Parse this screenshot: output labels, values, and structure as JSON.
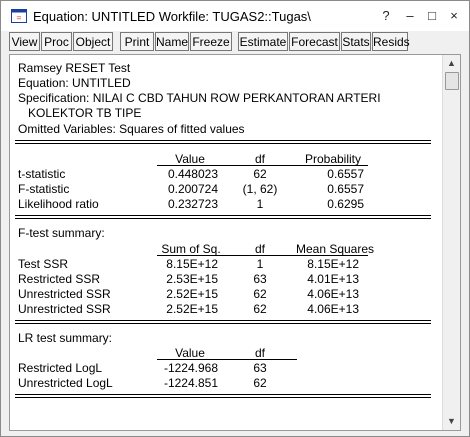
{
  "window": {
    "title": "Equation: UNTITLED   Workfile: TUGAS2::Tugas\\",
    "controls": [
      "?",
      "–",
      "□",
      "×"
    ]
  },
  "toolbar": {
    "buttons": [
      "View",
      "Proc",
      "Object",
      "Print",
      "Name",
      "Freeze",
      "Estimate",
      "Forecast",
      "Stats",
      "Resids"
    ]
  },
  "output": {
    "heading": "Ramsey RESET Test",
    "equation": "Equation: UNTITLED",
    "specification_line1": "Specification: NILAI C CBD TAHUN ROW PERKANTORAN ARTERI",
    "specification_line2": "KOLEKTOR TB TIPE",
    "omitted": "Omitted Variables: Squares of fitted values",
    "test_table": {
      "headers": [
        "Value",
        "df",
        "Probability"
      ],
      "rows": [
        {
          "label": "t-statistic",
          "value": "0.448023",
          "df": "62",
          "prob": "0.6557"
        },
        {
          "label": "F-statistic",
          "value": "0.200724",
          "df": "(1, 62)",
          "prob": "0.6557"
        },
        {
          "label": "Likelihood ratio",
          "value": "0.232723",
          "df": "1",
          "prob": "0.6295"
        }
      ]
    },
    "ftest": {
      "title": "F-test summary:",
      "headers": [
        "Sum of Sq.",
        "df",
        "Mean Squares"
      ],
      "rows": [
        {
          "label": "Test SSR",
          "ss": "8.15E+12",
          "df": "1",
          "ms": "8.15E+12"
        },
        {
          "label": "Restricted SSR",
          "ss": "2.53E+15",
          "df": "63",
          "ms": "4.01E+13"
        },
        {
          "label": "Unrestricted SSR",
          "ss": "2.52E+15",
          "df": "62",
          "ms": "4.06E+13"
        },
        {
          "label": "Unrestricted SSR",
          "ss": "2.52E+15",
          "df": "62",
          "ms": "4.06E+13"
        }
      ]
    },
    "lrtest": {
      "title": "LR test summary:",
      "headers": [
        "Value",
        "df"
      ],
      "rows": [
        {
          "label": "Restricted LogL",
          "value": "-1224.968",
          "df": "63"
        },
        {
          "label": "Unrestricted LogL",
          "value": "-1224.851",
          "df": "62"
        }
      ]
    }
  },
  "colors": {
    "accent": "#1a3f9e",
    "icon_red": "#c0392b"
  }
}
